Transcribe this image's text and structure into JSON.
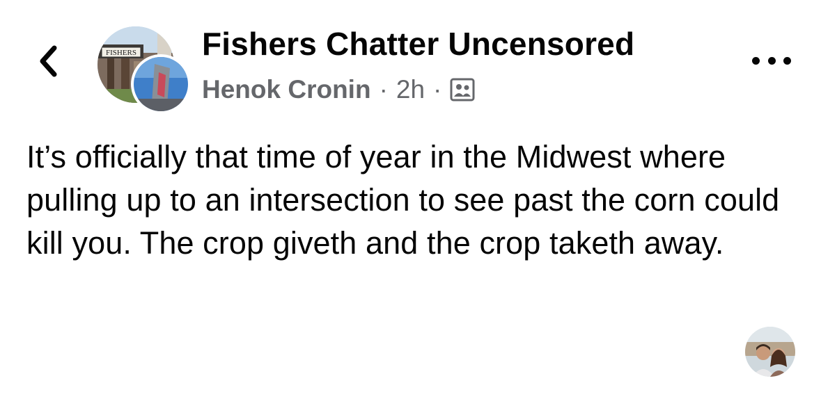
{
  "header": {
    "back_icon": "chevron-left-icon",
    "group_avatar_sign_text": "FISHERS",
    "group_name": "Fishers Chatter Uncensored",
    "author": "Henok Cronin",
    "separator": "·",
    "time": "2h",
    "audience_icon": "group-members-icon",
    "more_icon": "more-options-icon"
  },
  "post": {
    "text": "It’s officially that time of year in the Midwest where pulling up to an intersection to see past the corn could kill you. The crop giveth and the crop taketh away."
  },
  "footer": {
    "reactor_avatar_icon": "user-avatar"
  }
}
